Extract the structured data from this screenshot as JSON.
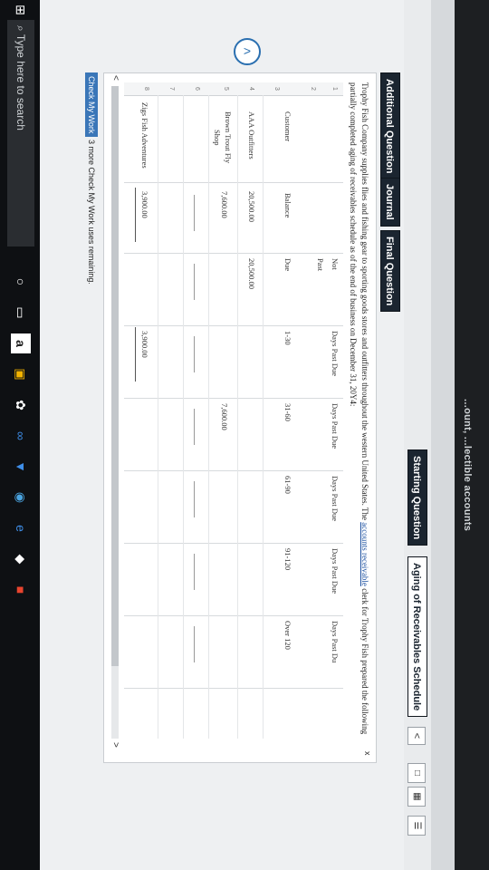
{
  "window": {
    "heading": "...ount, ...lectible accounts"
  },
  "tabs_row1": [
    {
      "label": "Starting Question",
      "active": false
    },
    {
      "label": "Aging of Receivables Schedule",
      "active": true
    }
  ],
  "tabs_row2": [
    {
      "label": "Additional Question"
    },
    {
      "label": "Journal"
    },
    {
      "label": "Final Question"
    }
  ],
  "nav": {
    "prev_arrow": "<",
    "next_arrow": ">"
  },
  "problem": {
    "text_part1": "Trophy Fish Company supplies flies and fishing gear to sporting goods stores and outfitters throughout the western United States. The ",
    "link": "accounts receivable",
    "text_part2": " clerk for Trophy Fish prepared the following partially completed aging of receivables schedule as of the end of business on December 31, 20Y4:",
    "close": "x"
  },
  "table": {
    "row_numbers": [
      "1",
      "2",
      "3",
      "4",
      "5",
      "6",
      "7",
      "8"
    ],
    "header_row1": [
      "",
      "",
      "Not",
      "Days Past Due",
      "Days Past Due",
      "Days Past Due",
      "Days Past Due",
      "Days Past Du"
    ],
    "header_row2": [
      "",
      "",
      "Past",
      "",
      "",
      "",
      "",
      ""
    ],
    "header_row3": [
      "Customer",
      "Balance",
      "Due",
      "1-30",
      "31-60",
      "61-90",
      "91-120",
      "Over 120"
    ],
    "rows": [
      {
        "customer": "AAA Outfitters",
        "balance": "20,500.00",
        "not_past_due": "20,500.00",
        "d1_30": "",
        "d31_60": "",
        "d61_90": "",
        "d91_120": "",
        "over120": ""
      },
      {
        "customer": "Brown Trout Fly",
        "customer2": "Shop",
        "balance": "7,600.00",
        "not_past_due": "",
        "d1_30": "",
        "d31_60": "7,600.00",
        "d61_90": "",
        "d91_120": "",
        "over120": ""
      },
      {
        "customer": "Zigs Fish Adventures",
        "balance": "3,900.00",
        "not_past_due": "",
        "d1_30": "3,900.00",
        "d31_60": "",
        "d61_90": "",
        "d91_120": "",
        "over120": ""
      }
    ]
  },
  "footer": {
    "check_label": "Check My Work",
    "remaining": "3 more Check My Work uses remaining."
  },
  "taskbar": {
    "search_placeholder": "Type here to search",
    "icons": [
      "start-icon",
      "search-icon",
      "cortana-icon",
      "task-view-icon",
      "amazon-icon",
      "store-icon",
      "dropbox-icon",
      "photos-icon",
      "chrome-icon",
      "edge-icon",
      "onenote-icon",
      "office-icon"
    ]
  }
}
